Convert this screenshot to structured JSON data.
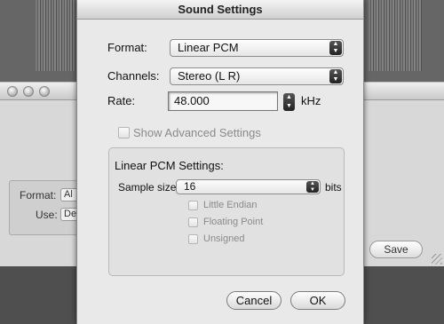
{
  "dialog": {
    "title": "Sound Settings",
    "format": {
      "label": "Format:",
      "value": "Linear PCM"
    },
    "channels": {
      "label": "Channels:",
      "value": "Stereo (L R)"
    },
    "rate": {
      "label": "Rate:",
      "value": "48.000",
      "unit": "kHz"
    },
    "show_advanced": {
      "label": "Show Advanced Settings",
      "checked": false,
      "enabled": false
    },
    "pcm": {
      "title": "Linear PCM Settings:",
      "sample_size": {
        "label": "Sample size:",
        "value": "16",
        "unit": "bits"
      },
      "options": [
        {
          "label": "Little Endian",
          "checked": false
        },
        {
          "label": "Floating Point",
          "checked": false
        },
        {
          "label": "Unsigned",
          "checked": false
        }
      ]
    },
    "cancel_label": "Cancel",
    "ok_label": "OK"
  },
  "background_window": {
    "format_label": "Format:",
    "format_value": "Al",
    "use_label": "Use:",
    "use_value": "De",
    "save_label": "Save"
  }
}
